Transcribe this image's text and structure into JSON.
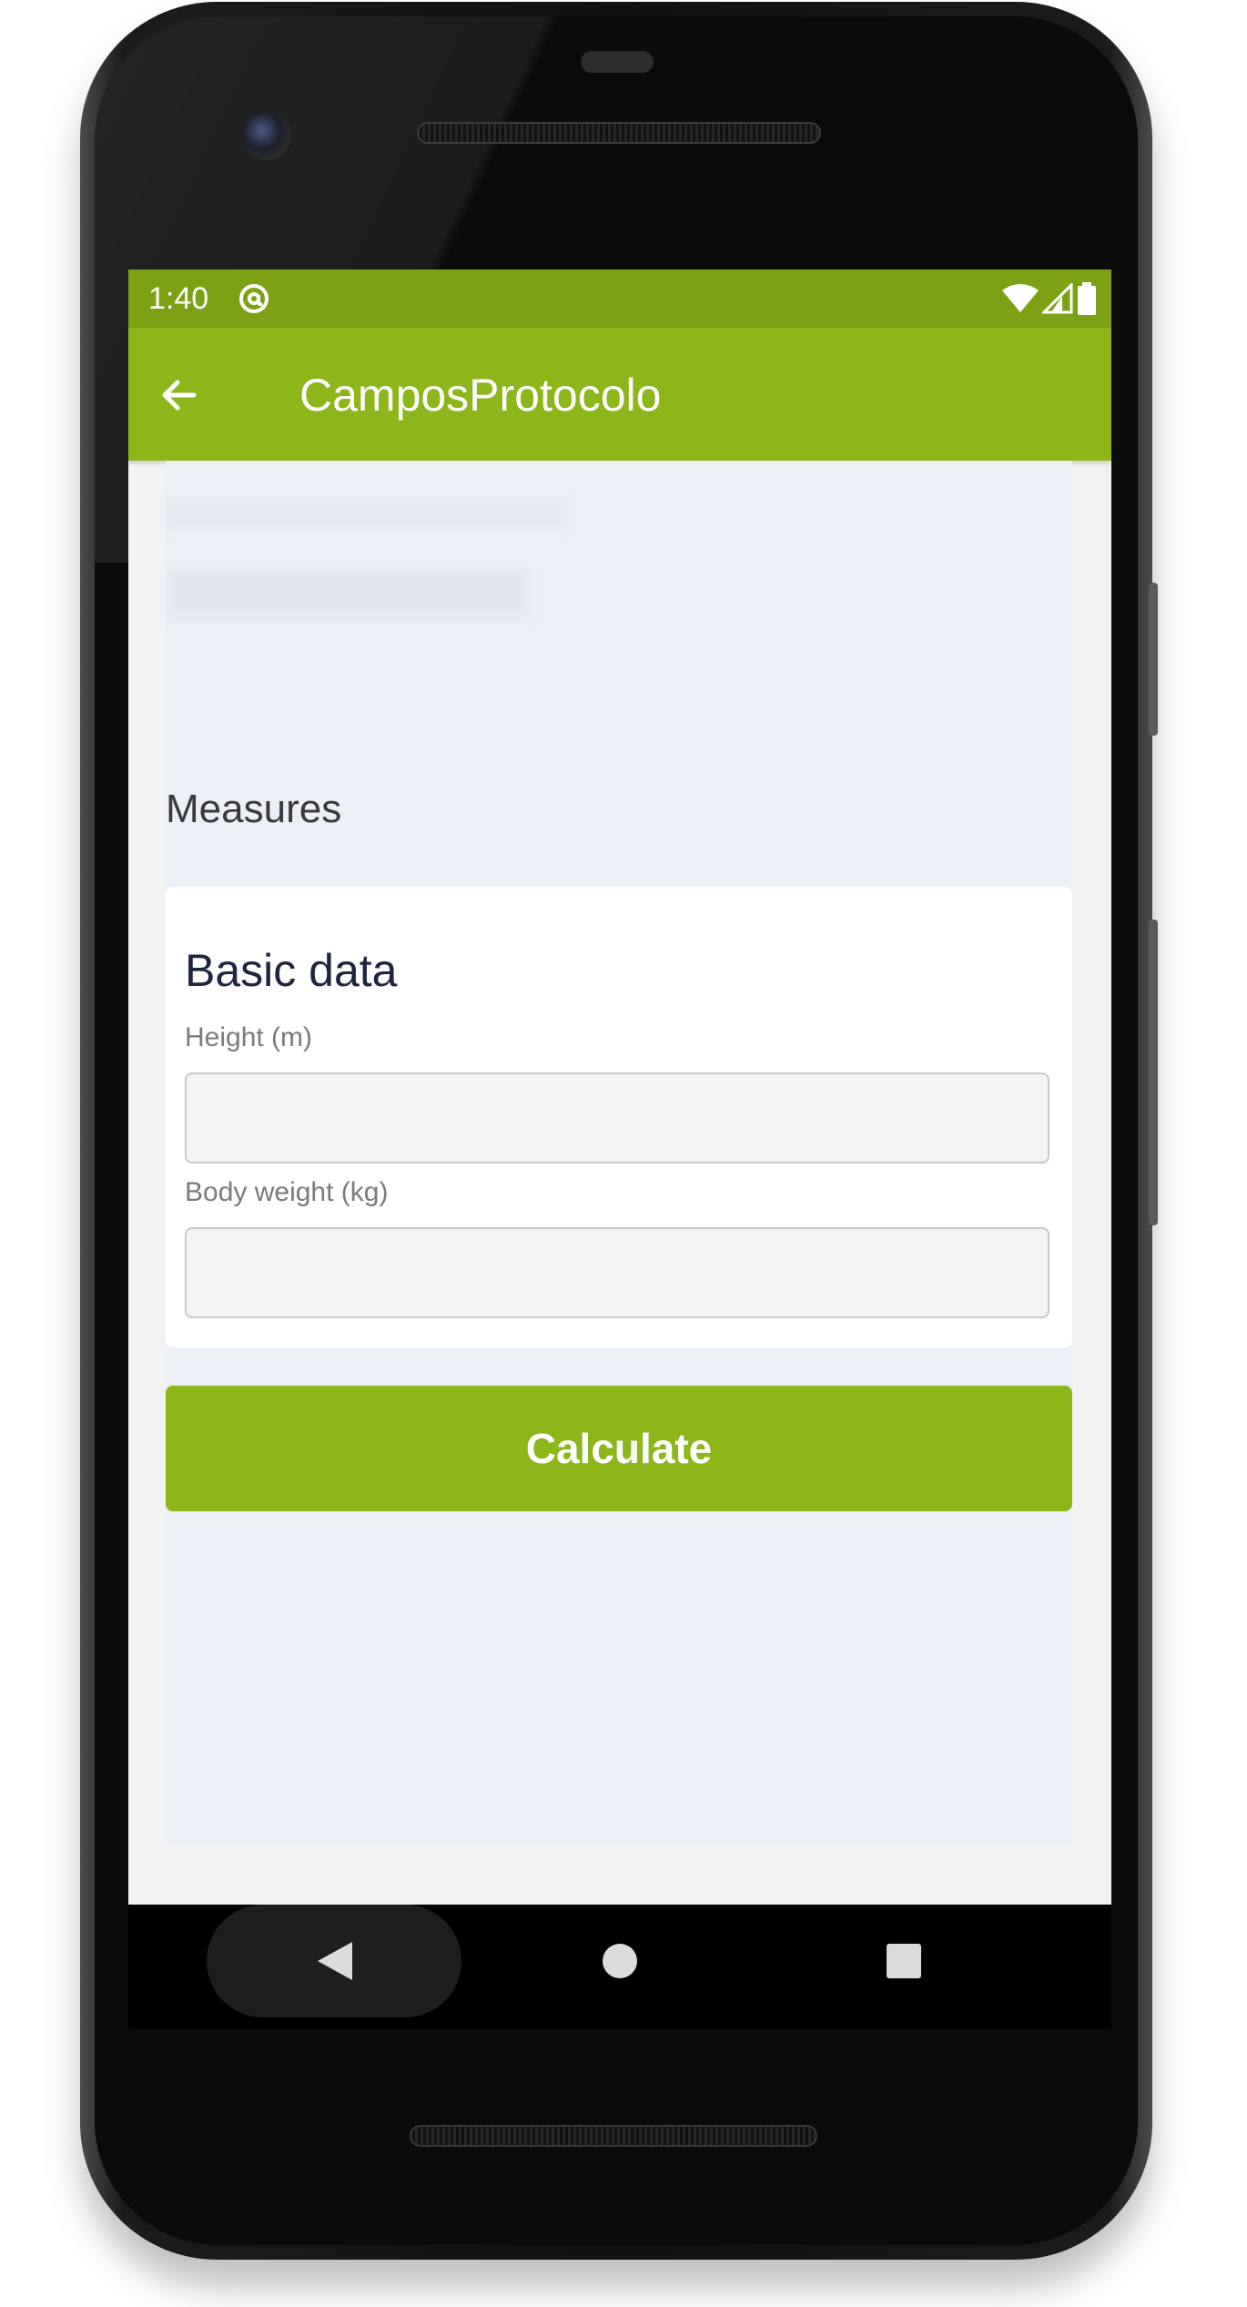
{
  "status_bar": {
    "time": "1:40",
    "app_icon": "at-sign-icon",
    "icons": [
      "wifi-icon",
      "cell-signal-icon",
      "battery-icon"
    ]
  },
  "app_bar": {
    "title": "CamposProtocolo",
    "back_icon": "arrow-left-icon"
  },
  "main": {
    "section_title": "Measures",
    "card": {
      "title": "Basic data",
      "fields": [
        {
          "label": "Height (m)",
          "value": "",
          "placeholder": ""
        },
        {
          "label": "Body weight (kg)",
          "value": "",
          "placeholder": ""
        }
      ]
    },
    "calculate_label": "Calculate"
  },
  "nav_bar": {
    "back_icon": "triangle-back-icon",
    "home_icon": "circle-home-icon",
    "recents_icon": "square-recents-icon"
  },
  "colors": {
    "status_bar": "#7ca114",
    "app_bar": "#8db61a",
    "button": "#8db61a",
    "content_bg": "#ebeff6",
    "screen_bg": "#f2f2f2"
  }
}
